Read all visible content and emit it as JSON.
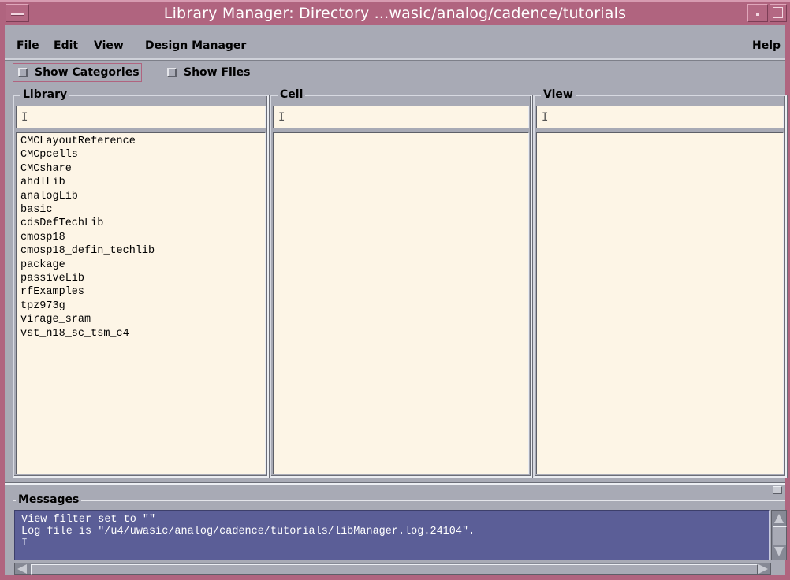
{
  "window": {
    "title": "Library Manager: Directory ...wasic/analog/cadence/tutorials"
  },
  "menubar": {
    "items": [
      {
        "mnemonic": "F",
        "rest": "ile"
      },
      {
        "mnemonic": "E",
        "rest": "dit"
      },
      {
        "mnemonic": "V",
        "rest": "iew"
      },
      {
        "mnemonic": "D",
        "rest": "esign Manager"
      }
    ],
    "help": {
      "mnemonic": "H",
      "rest": "elp"
    }
  },
  "options": {
    "show_categories": {
      "label": "Show Categories",
      "checked": false
    },
    "show_files": {
      "label": "Show Files",
      "checked": false
    }
  },
  "panes": {
    "library": {
      "label": "Library",
      "filter": "",
      "items": [
        "CMCLayoutReference",
        "CMCpcells",
        "CMCshare",
        "ahdlLib",
        "analogLib",
        "basic",
        "cdsDefTechLib",
        "cmosp18",
        "cmosp18_defin_techlib",
        "package",
        "passiveLib",
        "rfExamples",
        "tpz973g",
        "virage_sram",
        "vst_n18_sc_tsm_c4"
      ]
    },
    "cell": {
      "label": "Cell",
      "filter": "",
      "items": []
    },
    "view": {
      "label": "View",
      "filter": "",
      "items": []
    }
  },
  "messages": {
    "label": "Messages",
    "lines": [
      "View filter set to \"\"",
      "Log file is \"/u4/uwasic/analog/cadence/tutorials/libManager.log.24104\"."
    ]
  },
  "colors": {
    "title_bar": "#b0647f",
    "window_bg": "#a8aab5",
    "list_bg": "#fdf5e6",
    "message_bg": "#5b5e97"
  }
}
